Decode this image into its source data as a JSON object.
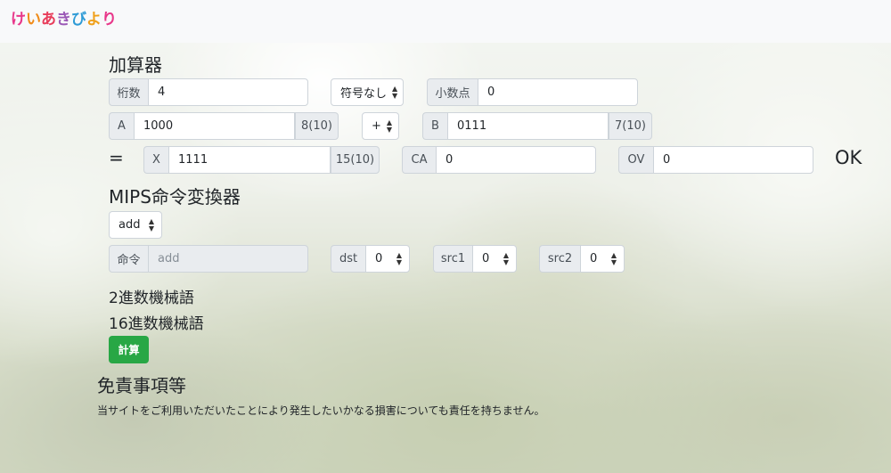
{
  "brand": {
    "logo_chars": [
      "け",
      "い",
      "あ",
      "き",
      "び",
      "よ",
      "り"
    ],
    "logo_colors": [
      "#e8378a",
      "#f08c1a",
      "#e83c5a",
      "#9b59b6",
      "#2e9bd6",
      "#f0a01a",
      "#e8378a"
    ]
  },
  "adder": {
    "title": "加算器",
    "digits_label": "桁数",
    "digits_value": "4",
    "sign_select": "符号なし",
    "decimal_label": "小数点",
    "decimal_value": "0",
    "a_label": "A",
    "a_value": "1000",
    "a_decimal": "8(10)",
    "operator": "+",
    "b_label": "B",
    "b_value": "0111",
    "b_decimal": "7(10)",
    "equals": "=",
    "x_label": "X",
    "x_value": "1111",
    "x_decimal": "15(10)",
    "ca_label": "CA",
    "ca_value": "0",
    "ov_label": "OV",
    "ov_value": "0",
    "status": "OK"
  },
  "mips": {
    "title": "MIPS命令変換器",
    "instruction_select": "add",
    "cmd_label": "命令",
    "cmd_placeholder": "add",
    "dst_label": "dst",
    "dst_value": "0",
    "src1_label": "src1",
    "src1_value": "0",
    "src2_label": "src2",
    "src2_value": "0",
    "binary_label": "2進数機械語",
    "hex_label": "16進数機械語",
    "calc_button": "計算"
  },
  "disclaimer": {
    "title": "免責事項等",
    "text": "当サイトをご利用いただいたことにより発生したいかなる損害についても責任を持ちません。"
  }
}
